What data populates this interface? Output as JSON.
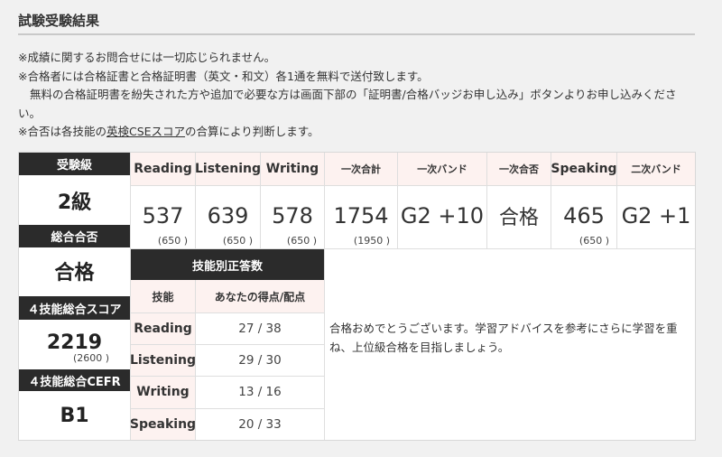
{
  "page": {
    "title": "試験受験結果"
  },
  "notes": [
    "※成績に関するお問合せには一切応じられません。",
    "※合格者には合格証書と合格証明書（英文・和文）各1通を無料で送付致します。",
    "無料の合格証明書を紛失された方や追加で必要な方は画面下部の「証明書/合格バッジお申し込み」ボタンよりお申し込みくださ",
    "い。"
  ],
  "note4": {
    "prefix": "※合否は各技能の",
    "link": "英検CSEスコア",
    "suffix": "の合算により判断します。"
  },
  "summary": {
    "grade_label": "受験級",
    "grade": "2級",
    "pass_label": "総合合否",
    "pass": "合格",
    "cse_label": "４技能総合スコア",
    "cse": "2219",
    "cse_max": "(2600 )",
    "cefr_label": "４技能総合CEFR",
    "cefr": "B1"
  },
  "scores": {
    "headers": [
      "Reading",
      "Listening",
      "Writing",
      "一次合計",
      "一次バンド",
      "一次合否",
      "Speaking",
      "二次バンド"
    ],
    "values": [
      "537",
      "639",
      "578",
      "1754",
      "G2 +10",
      "合格",
      "465",
      "G2 +1"
    ],
    "maxes": [
      "(650 )",
      "(650 )",
      "(650 )",
      "(1950 )",
      "",
      "",
      "(650 )",
      ""
    ]
  },
  "skills": {
    "title": "技能別正答数",
    "col_skill": "技能",
    "col_score": "あなたの得点/配点",
    "rows": [
      {
        "skill": "Reading",
        "score": "27 / 38"
      },
      {
        "skill": "Listening",
        "score": "29 / 30"
      },
      {
        "skill": "Writing",
        "score": "13 / 16"
      },
      {
        "skill": "Speaking",
        "score": "20 / 33"
      }
    ]
  },
  "message": "合格おめでとうございます。学習アドバイスを参考にさらに学習を重ね、上位級合格を目指しましょう。"
}
